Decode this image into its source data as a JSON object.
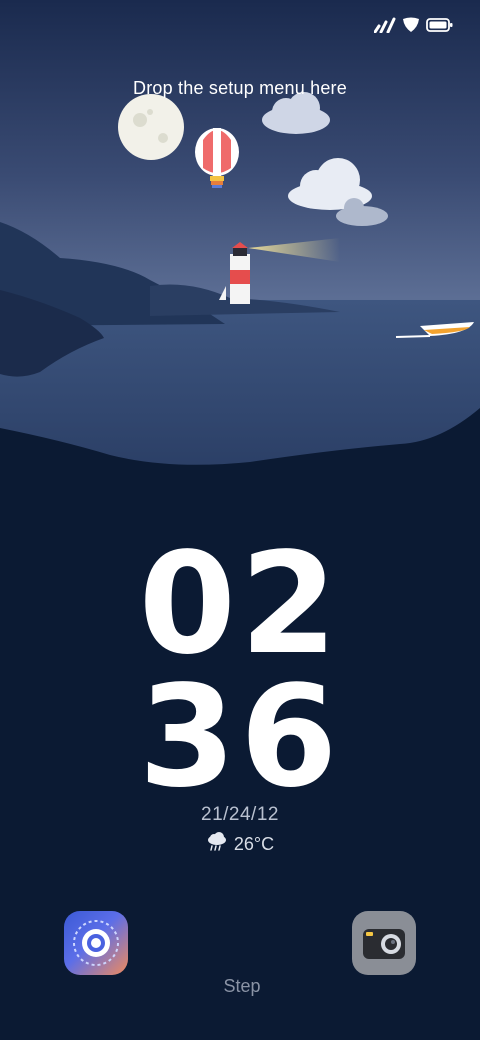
{
  "status_bar": {
    "icons": [
      "signal-icon",
      "wifi-shield-icon",
      "battery-icon"
    ]
  },
  "hint_text": "Drop the setup menu here",
  "clock": {
    "hours": "02",
    "minutes": "36"
  },
  "date": "21/24/12",
  "weather": {
    "icon": "rain-cloud-icon",
    "temperature": "26°C"
  },
  "shortcuts": {
    "left_icon": "settings-dial-icon",
    "right_icon": "camera-icon",
    "center_label": "Step"
  },
  "colors": {
    "sky_top": "#1a2a4e",
    "sky_bottom": "#5d6f94",
    "ground": "#0b1a33",
    "accent_red": "#e54d4d"
  }
}
